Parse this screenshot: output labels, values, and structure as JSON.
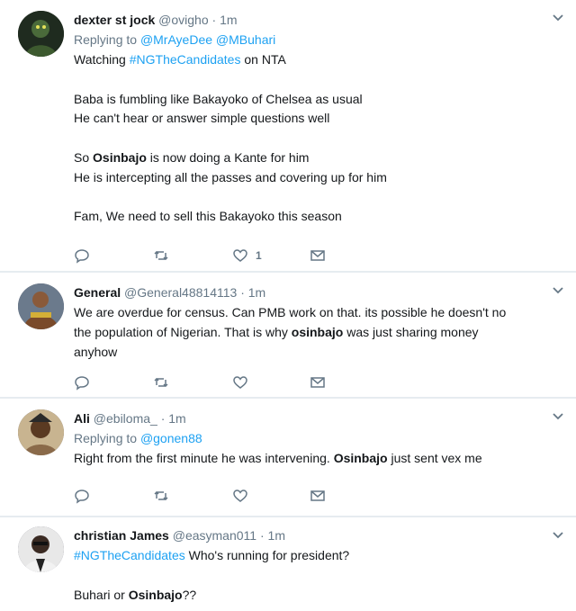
{
  "colors": {
    "link": "#1da1f2",
    "muted": "#657786",
    "text": "#14171a",
    "separator": "#e6ecf0"
  },
  "tweets": [
    {
      "name": "dexter st jock",
      "handle": "@ovigho",
      "dot": "·",
      "time": "1m",
      "reply_prefix": "Replying to",
      "reply_handles": "@MrAyeDee @MBuhari",
      "line1_pre": "Watching ",
      "line1_hashtag": "#NGTheCandidates",
      "line1_post": " on NTA",
      "line2": "Baba is fumbling like Bakayoko of Chelsea as usual",
      "line3": "He can't hear or answer simple questions well",
      "line4_pre": "So ",
      "line4_bold": "Osinbajo",
      "line4_post": " is now doing a Kante for him",
      "line5": "He is intercepting all the passes and covering up for him",
      "line6": "Fam, We need to sell this Bakayoko this season",
      "like_count": "1",
      "icons": [
        "reply-icon",
        "retweet-icon",
        "heart-icon",
        "message-icon",
        "chevron-down-icon"
      ]
    },
    {
      "name": "General",
      "handle": "@General48814113",
      "dot": "·",
      "time": "1m",
      "line1": "We are overdue for census. Can PMB work on that. its possible he doesn't no",
      "line2": "the population of Nigerian. That is why ",
      "line2_bold": "osinbajo",
      "line2_post": " was just sharing money",
      "line3": "anyhow"
    },
    {
      "name": "Ali",
      "handle": "@ebiloma_",
      "dot": "·",
      "time": "1m",
      "reply_prefix": "Replying to",
      "reply_handles": "@gonen88",
      "line1_pre": "Right from the first minute he was intervening. ",
      "line1_bold": "Osinbajo",
      "line1_post": " just sent vex me"
    },
    {
      "name": "christian James",
      "handle": "@easyman011",
      "dot": "·",
      "time": "1m",
      "line1_hashtag": "#NGTheCandidates",
      "line1_post": " Who's running for president?",
      "line2_pre": "Buhari or ",
      "line2_bold": "Osinbajo",
      "line2_post": "??"
    }
  ]
}
